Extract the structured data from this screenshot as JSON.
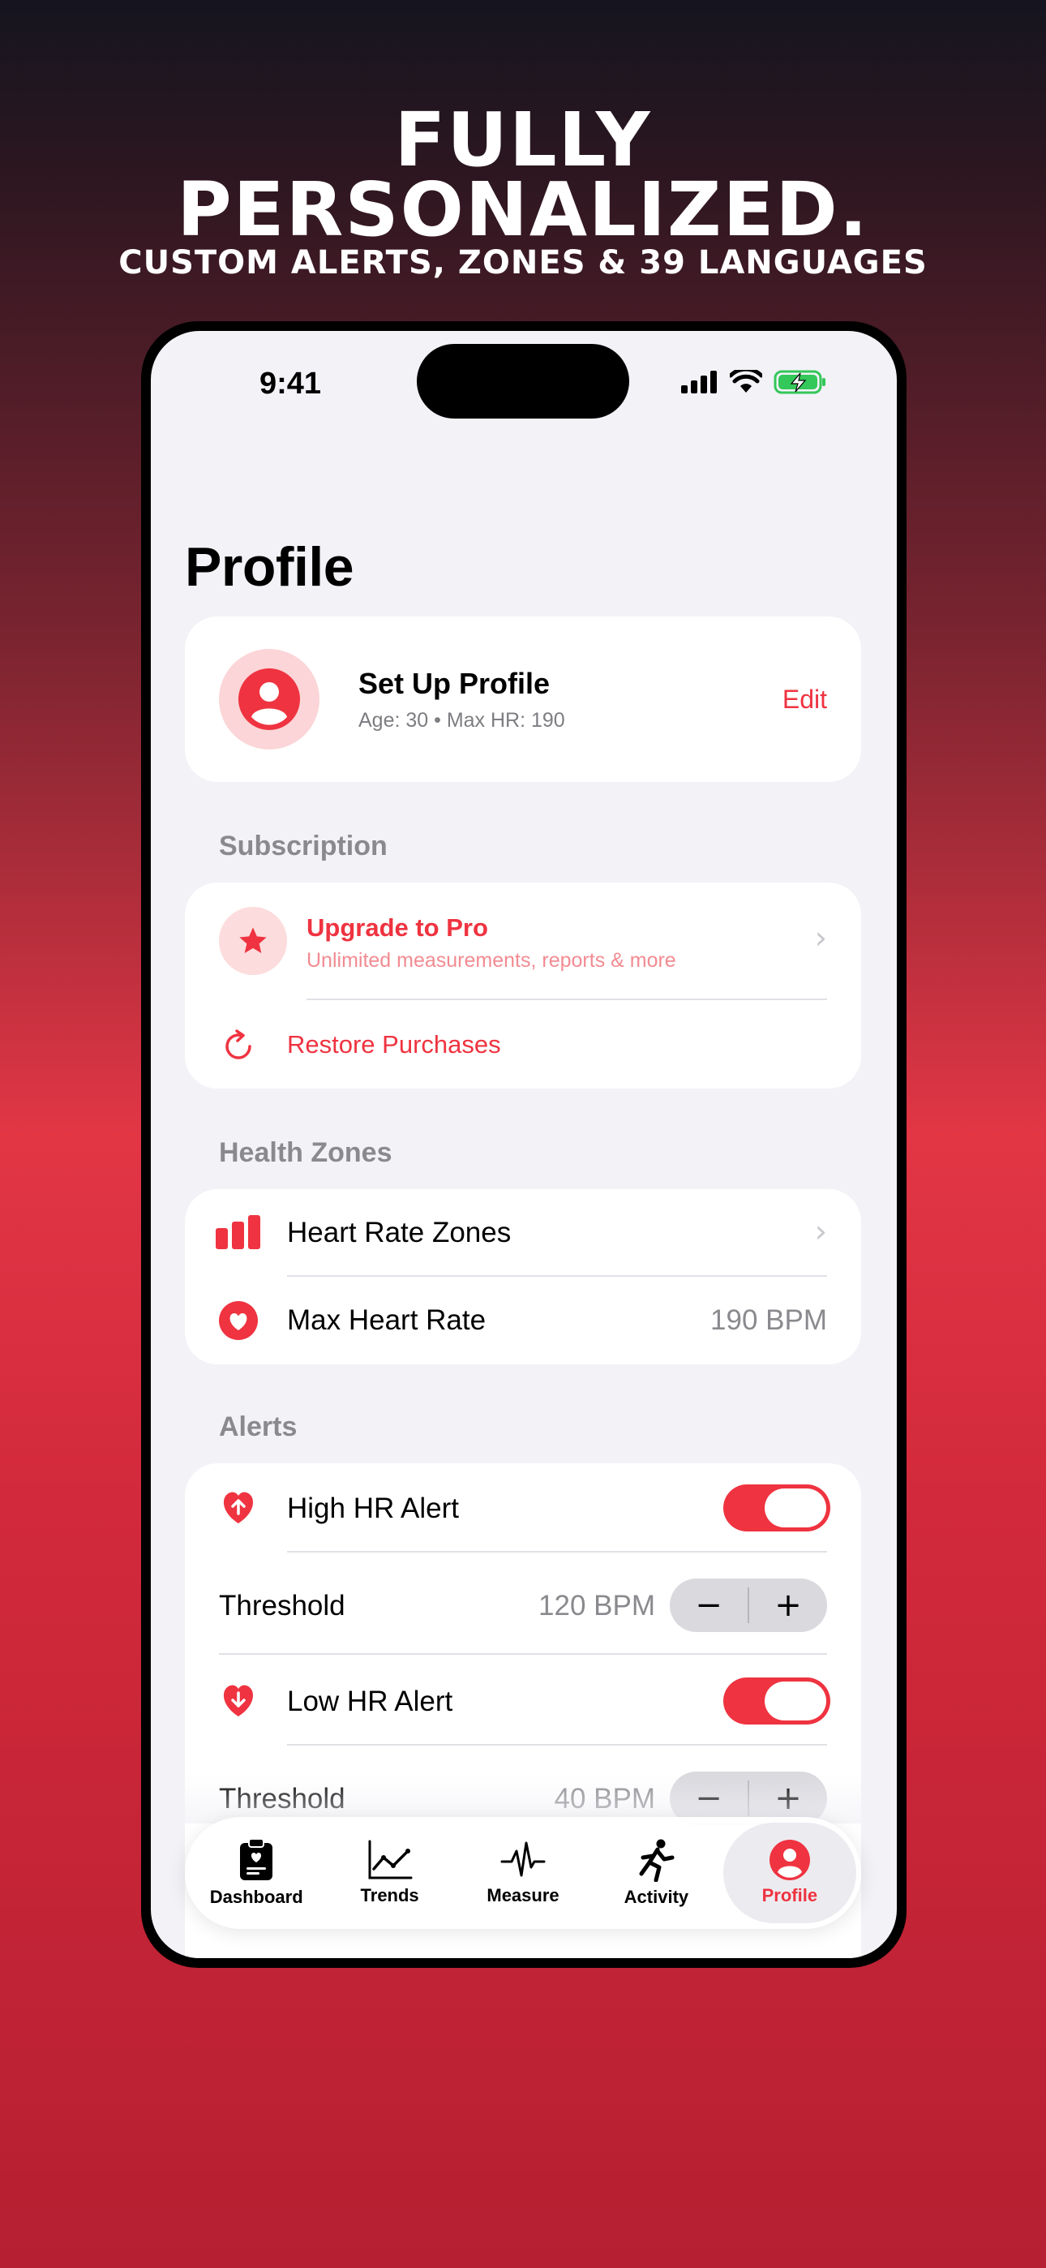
{
  "hero": {
    "line1": "FULLY",
    "line2": "PERSONALIZED.",
    "subtitle": "CUSTOM ALERTS, ZONES & 39 LANGUAGES"
  },
  "status_bar": {
    "time": "9:41"
  },
  "page_title": "Profile",
  "profile": {
    "name": "Set Up Profile",
    "meta": "Age: 30 • Max HR: 190",
    "edit_label": "Edit"
  },
  "subscription": {
    "header": "Subscription",
    "upgrade_title": "Upgrade to Pro",
    "upgrade_subtitle": "Unlimited measurements, reports & more",
    "restore_label": "Restore Purchases"
  },
  "health_zones": {
    "header": "Health Zones",
    "heart_rate_zones_label": "Heart Rate Zones",
    "max_hr_label": "Max Heart Rate",
    "max_hr_value": "190 BPM"
  },
  "alerts": {
    "header": "Alerts",
    "high_label": "High HR Alert",
    "high_on": true,
    "high_threshold_label": "Threshold",
    "high_threshold_value": "120 BPM",
    "low_label": "Low HR Alert",
    "low_on": true,
    "low_threshold_label": "Threshold",
    "low_threshold_value": "40 BPM"
  },
  "tabs": [
    {
      "label": "Dashboard",
      "icon": "clipboard-icon",
      "active": false
    },
    {
      "label": "Trends",
      "icon": "trend-chart-icon",
      "active": false
    },
    {
      "label": "Measure",
      "icon": "waveform-icon",
      "active": false
    },
    {
      "label": "Activity",
      "icon": "running-figure-icon",
      "active": false
    },
    {
      "label": "Profile",
      "icon": "person-circle-icon",
      "active": true
    }
  ],
  "colors": {
    "accent": "#ef3340",
    "background": "#f2f2f7",
    "secondary_text": "#8a8a8e"
  }
}
